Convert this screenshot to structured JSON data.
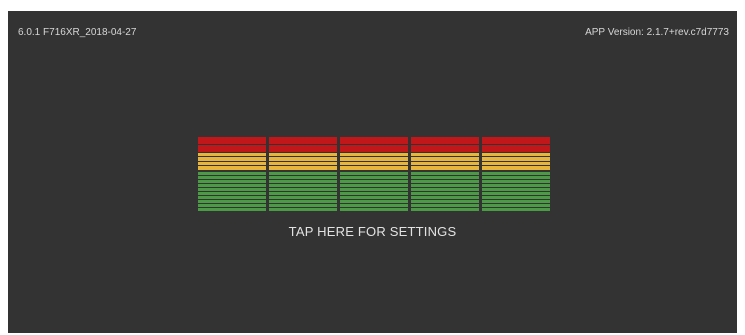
{
  "header": {
    "build_info": "6.0.1 F716XR_2018-04-27",
    "app_version": "APP Version: 2.1.7+rev.c7d7773"
  },
  "meter": {
    "columns": 5,
    "levels": [
      {
        "name": "red",
        "color": "#c0171a"
      },
      {
        "name": "yellow",
        "color": "#e8b53c"
      },
      {
        "name": "green",
        "color": "#4c9a45"
      }
    ]
  },
  "settings": {
    "label": "TAP HERE FOR SETTINGS"
  },
  "colors": {
    "background": "#333333",
    "text": "#d6d6d6"
  }
}
